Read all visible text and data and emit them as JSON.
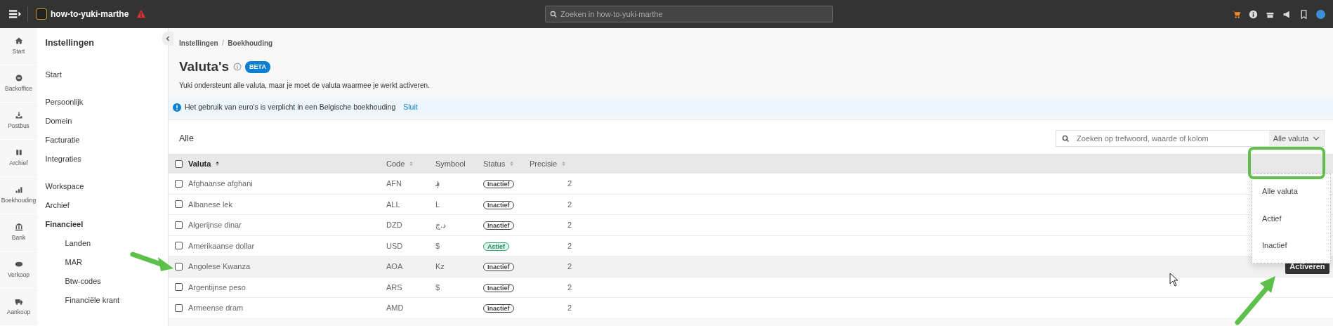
{
  "topbar": {
    "title": "how-to-yuki-marthe",
    "search_placeholder": "Zoeken in how-to-yuki-marthe"
  },
  "rail": [
    {
      "label": "Start"
    },
    {
      "label": "Backoffice"
    },
    {
      "label": "Postbus"
    },
    {
      "label": "Archief"
    },
    {
      "label": "Boekhouding"
    },
    {
      "label": "Bank"
    },
    {
      "label": "Verkoop"
    },
    {
      "label": "Aankoop"
    }
  ],
  "sidebar": {
    "title": "Instellingen",
    "sections": [
      {
        "items": [
          {
            "label": "Start",
            "expanded": false
          }
        ]
      },
      {
        "items": [
          {
            "label": "Persoonlijk",
            "expanded": false
          },
          {
            "label": "Domein",
            "expanded": false
          },
          {
            "label": "Facturatie",
            "expanded": false
          },
          {
            "label": "Integraties",
            "expanded": false
          }
        ]
      },
      {
        "items": [
          {
            "label": "Workspace",
            "expanded": false
          },
          {
            "label": "Archief",
            "expanded": false
          },
          {
            "label": "Financieel",
            "expanded": true,
            "children": [
              {
                "label": "Landen"
              },
              {
                "label": "MAR"
              },
              {
                "label": "Btw-codes"
              },
              {
                "label": "Financiële krant"
              }
            ]
          }
        ]
      }
    ]
  },
  "breadcrumb": {
    "separator": "/",
    "items": [
      "Instellingen",
      "Boekhouding"
    ]
  },
  "page": {
    "title": "Valuta's",
    "badge": "BETA",
    "subtitle": "Yuki ondersteunt alle valuta, maar je moet de valuta waarmee je werkt activeren."
  },
  "notice": {
    "text": "Het gebruik van euro's is verplicht in een Belgische boekhouding",
    "link": "Sluit"
  },
  "table": {
    "title": "Alle",
    "search_placeholder": "Zoeken op trefwoord, waarde of kolom",
    "filter": "Alle valuta",
    "all_checked": false,
    "filter_options": [
      {
        "label": "Alle valuta"
      },
      {
        "label": "Actief"
      },
      {
        "label": "Inactief"
      }
    ],
    "columns": [
      {
        "label": "Valuta",
        "sortable": true,
        "sorted": true
      },
      {
        "label": "Code",
        "sortable": true,
        "sorted": false
      },
      {
        "label": "Symbool",
        "sortable": false,
        "sorted": false
      },
      {
        "label": "Status",
        "sortable": true,
        "sorted": false
      },
      {
        "label": "Precisie",
        "sortable": true,
        "sorted": false
      }
    ],
    "rows": [
      {
        "name": "Afghaanse afghani",
        "code": "AFN",
        "symbol": "؋",
        "status": "Inactief",
        "active": false,
        "precision": "2",
        "hovered": false,
        "checked": false
      },
      {
        "name": "Albanese lek",
        "code": "ALL",
        "symbol": "L",
        "status": "Inactief",
        "active": false,
        "precision": "2",
        "hovered": false,
        "checked": false
      },
      {
        "name": "Algerijnse dinar",
        "code": "DZD",
        "symbol": "د.ج",
        "status": "Inactief",
        "active": false,
        "precision": "2",
        "hovered": false,
        "checked": false
      },
      {
        "name": "Amerikaanse dollar",
        "code": "USD",
        "symbol": "$",
        "status": "Actief",
        "active": true,
        "precision": "2",
        "hovered": false,
        "checked": false
      },
      {
        "name": "Angolese Kwanza",
        "code": "AOA",
        "symbol": "Kz",
        "status": "Inactief",
        "active": false,
        "precision": "2",
        "hovered": true,
        "checked": false,
        "action": "Activeren"
      },
      {
        "name": "Argentijnse peso",
        "code": "ARS",
        "symbol": "$",
        "status": "Inactief",
        "active": false,
        "precision": "2",
        "hovered": false,
        "checked": false
      },
      {
        "name": "Armeense dram",
        "code": "AMD",
        "status": "Inactief",
        "active": false,
        "precision": "2",
        "hovered": false,
        "checked": false
      }
    ]
  }
}
